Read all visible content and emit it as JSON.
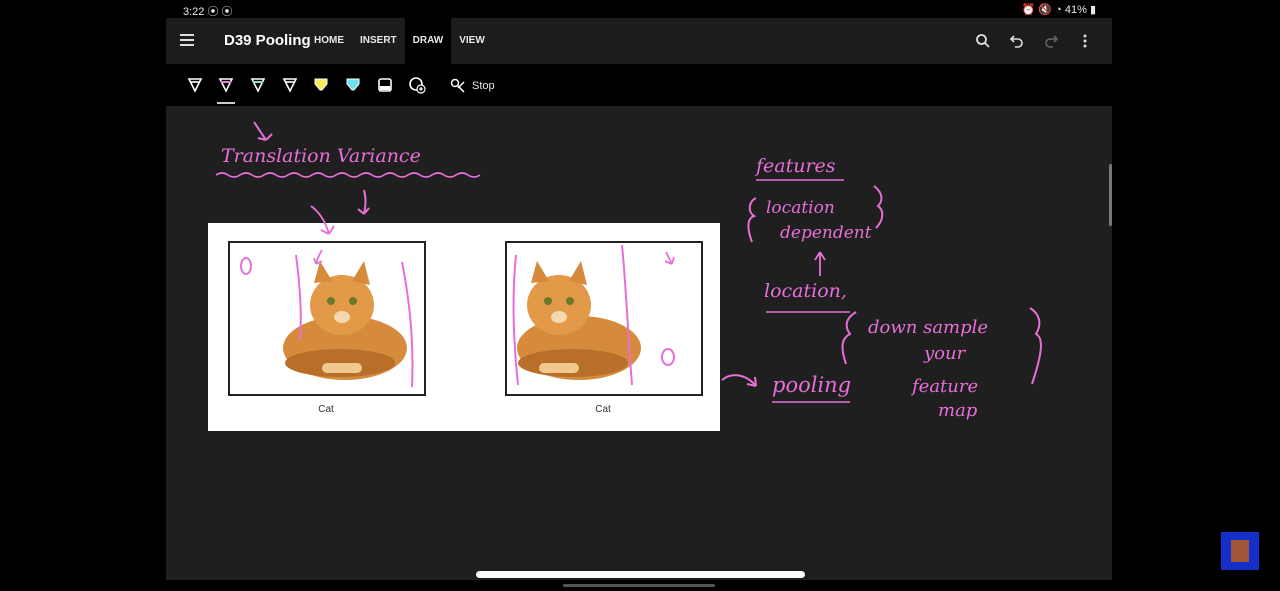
{
  "status_bar": {
    "time": "3:22",
    "time_icons": "⦿ ⦿",
    "battery": "41%"
  },
  "app": {
    "title": "D39 Pooling",
    "tabs": [
      {
        "label": "HOME"
      },
      {
        "label": "INSERT"
      },
      {
        "label": "DRAW",
        "active": true
      },
      {
        "label": "VIEW"
      }
    ],
    "actions": [
      "search-icon",
      "undo-icon",
      "redo-icon",
      "more-icon"
    ]
  },
  "draw_toolbar": {
    "pens": [
      {
        "name": "pen-white",
        "color": "#ffffff"
      },
      {
        "name": "pen-pink",
        "color": "#f07be0",
        "selected": true
      },
      {
        "name": "pen-mint",
        "color": "#7fe3c2"
      },
      {
        "name": "pen-white-2",
        "color": "#ffffff"
      },
      {
        "name": "highlighter-yellow",
        "color": "#f5ea5a"
      },
      {
        "name": "highlighter-cyan",
        "color": "#6fe0ee"
      },
      {
        "name": "eraser",
        "color": "#ffffff"
      },
      {
        "name": "add-pen",
        "color": "#ffffff"
      }
    ],
    "stop_label": "Stop"
  },
  "slide": {
    "left_caption": "Cat",
    "right_caption": "Cat"
  },
  "ink_notes": {
    "heading": "Translation Variance",
    "features": "features",
    "location_dependent_1": "location",
    "location_dependent_2": "dependent",
    "location": "location,",
    "pooling": "pooling",
    "down_sample_1": "down sample",
    "down_sample_2": "your",
    "down_sample_3": "feature",
    "down_sample_4": "map"
  },
  "colors": {
    "ink": "#e86fd8",
    "background": "#1f1f1f",
    "appbar": "#1c1c1c"
  }
}
